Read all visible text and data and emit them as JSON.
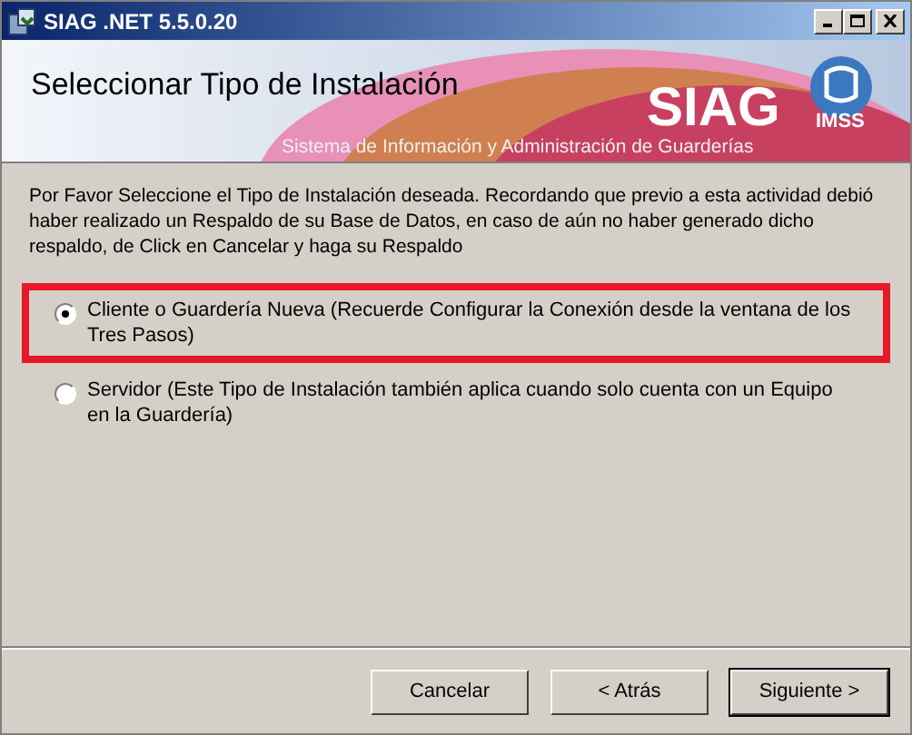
{
  "window": {
    "title": "SIAG .NET 5.5.0.20"
  },
  "header": {
    "title": "Seleccionar Tipo de Instalación",
    "logo_text": "SIAG",
    "logo_sub": "IMSS",
    "tagline": "Sistema de Información y Administración de Guarderías"
  },
  "instructions": "Por Favor Seleccione el Tipo de Instalación deseada. Recordando que previo a esta actividad debió haber realizado un Respaldo de su Base de Datos, en caso de aún no haber generado dicho respaldo, de Click en Cancelar y haga su Respaldo",
  "options": [
    {
      "label": "Cliente o Guardería Nueva (Recuerde Configurar la Conexión desde la ventana de los Tres Pasos)",
      "selected": true,
      "highlighted": true
    },
    {
      "label": "Servidor (Este Tipo de Instalación también aplica cuando solo cuenta con un Equipo en la Guardería)",
      "selected": false,
      "highlighted": false
    }
  ],
  "buttons": [
    {
      "label": "Cancelar",
      "default": false
    },
    {
      "label": "< Atrás",
      "default": false
    },
    {
      "label": "Siguiente >",
      "default": true
    }
  ]
}
